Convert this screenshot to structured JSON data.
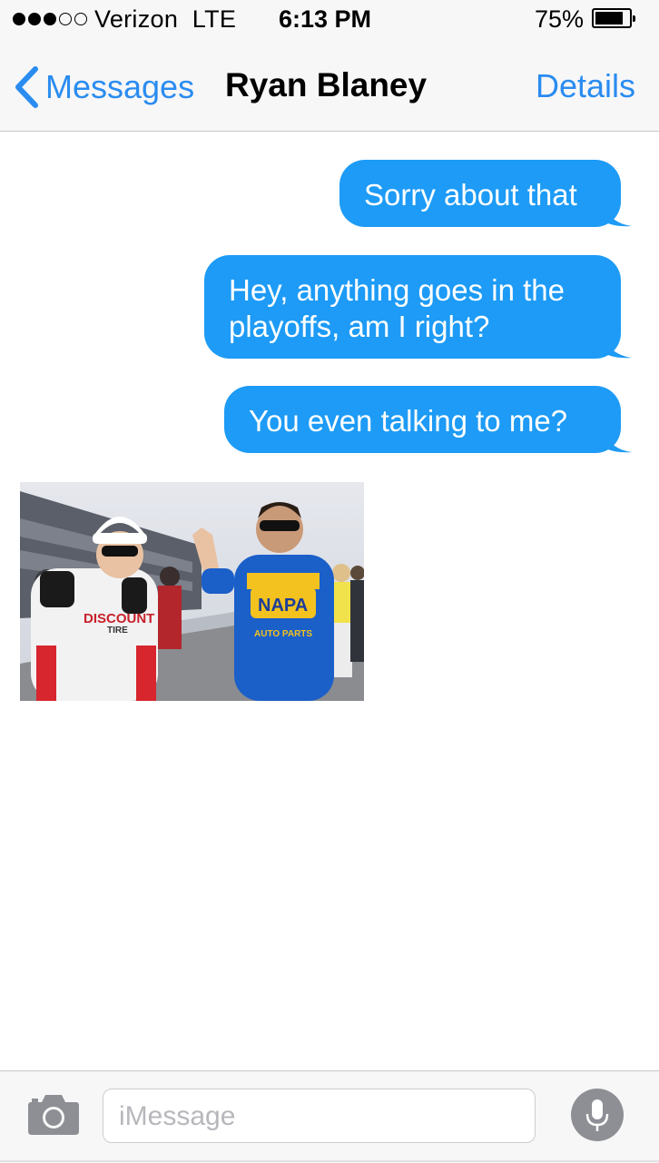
{
  "status_bar": {
    "carrier": "Verizon",
    "network": "LTE",
    "time": "6:13 PM",
    "battery_percent": "75%",
    "battery_level": 0.75,
    "signal_bars_filled": 3,
    "signal_bars_total": 5
  },
  "nav": {
    "back_label": "Messages",
    "contact_name": "Ryan Blaney",
    "details_label": "Details"
  },
  "messages": [
    {
      "direction": "sent",
      "text": "Sorry about that"
    },
    {
      "direction": "sent",
      "lines": [
        "Hey, anything goes in the",
        "playoffs, am I right?"
      ]
    },
    {
      "direction": "sent",
      "text": "You even talking to me?"
    },
    {
      "direction": "received",
      "type": "photo",
      "visible_text": {
        "left_suit_brand": "DISCOUNT",
        "left_suit_sub": "TIRE",
        "right_suit_brand": "NAPA",
        "right_suit_sub": "AUTO PARTS"
      }
    }
  ],
  "input": {
    "placeholder": "iMessage"
  },
  "icons": {
    "back": "chevron-left-icon",
    "camera": "camera-icon",
    "mic": "microphone-icon",
    "battery": "battery-icon",
    "signal": "signal-dots-icon"
  },
  "colors": {
    "accent": "#2a8cf0",
    "bubble_sent": "#1d9bf6",
    "bar_background": "#f7f7f8"
  }
}
